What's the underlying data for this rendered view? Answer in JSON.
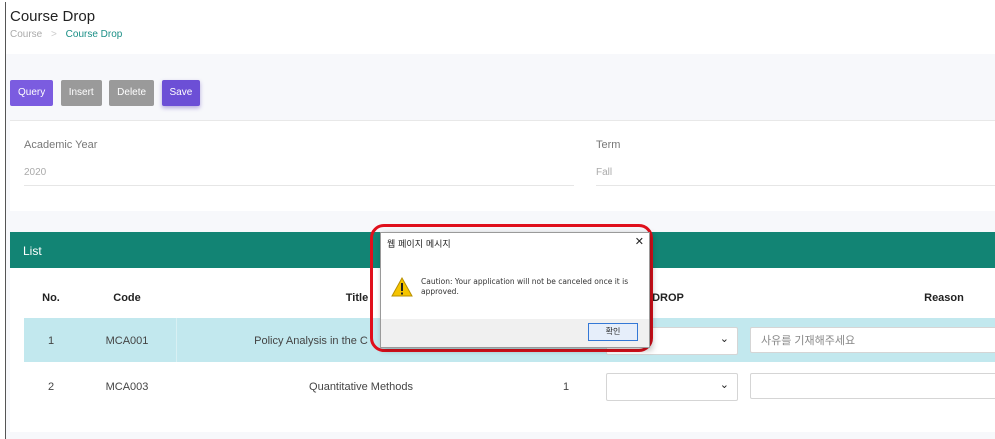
{
  "page": {
    "title": "Course Drop",
    "breadcrumb": [
      "Course",
      "Course Drop"
    ],
    "breadcrumb_separator": ">"
  },
  "toolbar": {
    "query_label": "Query",
    "insert_label": "Insert",
    "delete_label": "Delete",
    "save_label": "Save"
  },
  "filters": {
    "academic_year_label": "Academic Year",
    "academic_year_value": "2020",
    "term_label": "Term",
    "term_value": "Fall"
  },
  "list": {
    "header": "List",
    "columns": {
      "no": "No.",
      "code": "Code",
      "title": "Title",
      "drop": "DROP",
      "reason": "Reason"
    },
    "rows": [
      {
        "no": "1",
        "code": "MCA001",
        "title": "Policy Analysis in the C",
        "credit": "",
        "drop": "",
        "reason_placeholder": "사유를 기재해주세요"
      },
      {
        "no": "2",
        "code": "MCA003",
        "title": "Quantitative Methods",
        "credit": "1",
        "drop": "",
        "reason_placeholder": ""
      }
    ]
  },
  "dialog": {
    "title": "웹 페이지 메시지",
    "message": "Caution: Your application will not be canceled once it is approved.",
    "ok_label": "확인",
    "icon": "warning-icon",
    "highlight_color": "#e0101c"
  },
  "colors": {
    "accent_purple": "#7b5ce0",
    "teal": "#128474",
    "row_highlight": "#c2e8ee"
  }
}
